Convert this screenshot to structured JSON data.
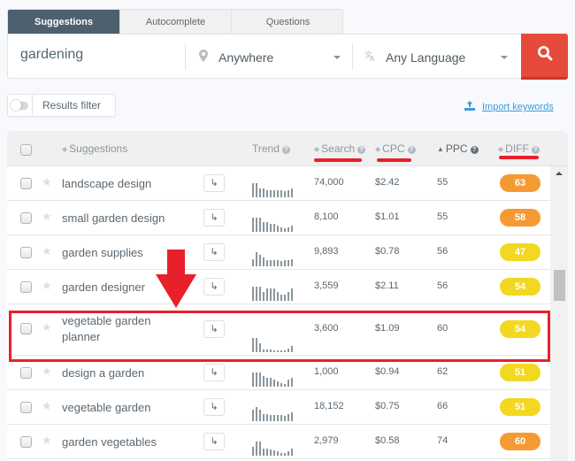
{
  "tabs": [
    {
      "label": "Suggestions",
      "active": true
    },
    {
      "label": "Autocomplete",
      "active": false
    },
    {
      "label": "Questions",
      "active": false
    }
  ],
  "search": {
    "keyword": "gardening",
    "location": "Anywhere",
    "language": "Any Language",
    "location_icon": "map-pin-icon",
    "language_icon": "translate-icon",
    "search_button_icon": "search-icon"
  },
  "filter": {
    "label": "Results filter",
    "enabled": false
  },
  "import": {
    "label": "Import keywords",
    "icon": "upload-icon"
  },
  "table": {
    "headers": {
      "suggestions": "Suggestions",
      "trend": "Trend",
      "search": "Search",
      "cpc": "CPC",
      "ppc": "PPC",
      "diff": "DIFF"
    },
    "go_icon": "↳",
    "rows": [
      {
        "keyword": "landscape design",
        "search": "74,000",
        "cpc": "$2.42",
        "ppc": "55",
        "diff": "63",
        "trend": [
          1.0,
          1.0,
          0.6,
          0.6,
          0.5,
          0.5,
          0.5,
          0.5,
          0.5,
          0.45,
          0.5,
          0.6
        ]
      },
      {
        "keyword": "small garden design",
        "search": "8,100",
        "cpc": "$1.01",
        "ppc": "55",
        "diff": "58",
        "trend": [
          1.0,
          1.0,
          1.0,
          0.7,
          0.7,
          0.55,
          0.55,
          0.45,
          0.3,
          0.25,
          0.3,
          0.45
        ]
      },
      {
        "keyword": "garden supplies",
        "search": "9,893",
        "cpc": "$0.78",
        "ppc": "56",
        "diff": "47",
        "trend": [
          0.5,
          1.0,
          0.8,
          0.6,
          0.45,
          0.45,
          0.45,
          0.45,
          0.35,
          0.45,
          0.45,
          0.5
        ]
      },
      {
        "keyword": "garden designer",
        "search": "3,559",
        "cpc": "$2.11",
        "ppc": "56",
        "diff": "54",
        "trend": [
          1.0,
          1.0,
          1.0,
          0.65,
          0.85,
          0.85,
          0.85,
          0.65,
          0.45,
          0.45,
          0.65,
          0.85
        ]
      },
      {
        "keyword": "vegetable garden planner",
        "search": "3,600",
        "cpc": "$1.09",
        "ppc": "60",
        "diff": "54",
        "trend": [
          1.0,
          1.0,
          0.6,
          0.2,
          0.2,
          0.2,
          0.15,
          0.15,
          0.1,
          0.15,
          0.25,
          0.45
        ]
      },
      {
        "keyword": "design a garden",
        "search": "1,000",
        "cpc": "$0.94",
        "ppc": "62",
        "diff": "51",
        "trend": [
          1.0,
          1.0,
          1.0,
          0.75,
          0.65,
          0.65,
          0.5,
          0.35,
          0.25,
          0.2,
          0.5,
          0.65
        ]
      },
      {
        "keyword": "vegetable garden",
        "search": "18,152",
        "cpc": "$0.75",
        "ppc": "66",
        "diff": "51",
        "trend": [
          0.8,
          1.0,
          0.8,
          0.5,
          0.5,
          0.45,
          0.45,
          0.45,
          0.45,
          0.35,
          0.5,
          0.65
        ]
      },
      {
        "keyword": "garden vegetables",
        "search": "2,979",
        "cpc": "$0.58",
        "ppc": "74",
        "diff": "60",
        "trend": [
          0.65,
          1.0,
          1.0,
          0.5,
          0.5,
          0.45,
          0.35,
          0.3,
          0.2,
          0.2,
          0.3,
          0.5
        ]
      }
    ]
  },
  "colors": {
    "tab_active": "#4d606e",
    "search_button": "#e64a3a",
    "link": "#3a9bd9",
    "diff_orange": "#f59a33",
    "diff_yellow": "#f2d820",
    "annotation_red": "#e8202a"
  }
}
